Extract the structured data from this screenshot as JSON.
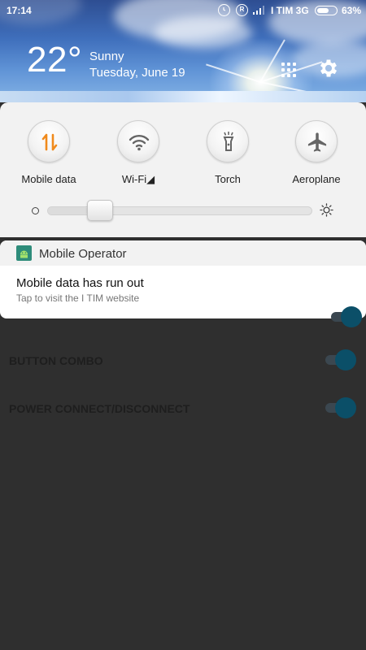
{
  "status_bar": {
    "time": "17:14",
    "carrier": "I TIM 3G",
    "battery_percent": "63%",
    "battery_level": 0.63,
    "icons": [
      "alarm-icon",
      "roaming-r-icon",
      "signal-icon",
      "battery-icon"
    ],
    "roaming_glyph": "R"
  },
  "weather": {
    "temperature": "22°",
    "condition": "Sunny",
    "date": "Tuesday, June 19"
  },
  "header_actions": {
    "apps_icon": "grid-icon",
    "settings_icon": "gear-icon"
  },
  "quick_settings": {
    "tiles": [
      {
        "label": "Mobile data",
        "icon": "mobile-data-icon",
        "active": true,
        "accent": "#f08a1c"
      },
      {
        "label": "Wi-Fi◢",
        "icon": "wifi-icon",
        "active": false
      },
      {
        "label": "Torch",
        "icon": "torch-icon",
        "active": false
      },
      {
        "label": "Aeroplane",
        "icon": "aeroplane-icon",
        "active": false
      }
    ],
    "brightness": {
      "level": 0.15,
      "min_icon": "brightness-low-icon",
      "max_icon": "brightness-high-icon"
    }
  },
  "notification": {
    "app_name": "Mobile Operator",
    "app_icon": "android-icon",
    "app_icon_color": "#2e8c7a",
    "title": "Mobile data has run out",
    "text": "Tap to visit the I TIM website"
  },
  "background_app": {
    "rows": [
      {
        "label": "BUTTON COMBO",
        "toggle_on": true
      },
      {
        "label": "POWER CONNECT/DISCONNECT",
        "toggle_on": true
      }
    ],
    "toggle_color": "#0b4f68"
  }
}
